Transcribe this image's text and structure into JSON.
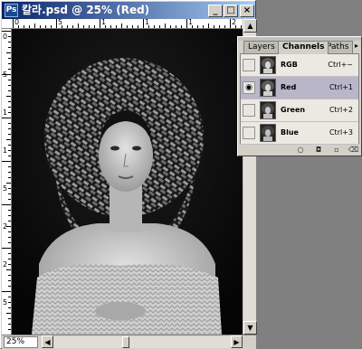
{
  "window": {
    "title": "칼라.psd @ 25% (Red)",
    "app_icon": "photoshop-icon",
    "minimize": "_",
    "maximize": "□",
    "close": "×"
  },
  "rulers": {
    "top_labels": [
      "0",
      "5",
      "1",
      "1",
      "1",
      "2"
    ],
    "left_labels": [
      "0",
      "5",
      "1",
      "1",
      "5",
      "2",
      "2",
      "5"
    ]
  },
  "document": {
    "image": "grayscale-portrait-woman-braided-headdress"
  },
  "status": {
    "zoom": "25%"
  },
  "channels_panel": {
    "tabs": [
      {
        "label": "Layers",
        "active": false
      },
      {
        "label": "Channels",
        "active": true
      },
      {
        "label": "Paths",
        "active": false
      }
    ],
    "menu_icon": "panel-menu-arrow-icon",
    "channels": [
      {
        "name": "RGB",
        "shortcut": "Ctrl+~",
        "visible": false,
        "selected": false
      },
      {
        "name": "Red",
        "shortcut": "Ctrl+1",
        "visible": true,
        "selected": true
      },
      {
        "name": "Green",
        "shortcut": "Ctrl+2",
        "visible": false,
        "selected": false
      },
      {
        "name": "Blue",
        "shortcut": "Ctrl+3",
        "visible": false,
        "selected": false
      }
    ],
    "footer_icons": [
      "load-selection-icon",
      "save-selection-icon",
      "new-channel-icon",
      "delete-channel-icon"
    ]
  },
  "colors": {
    "title_start": "#0a246a",
    "title_end": "#a6caf0",
    "selected_row": "#b8b6c8"
  }
}
